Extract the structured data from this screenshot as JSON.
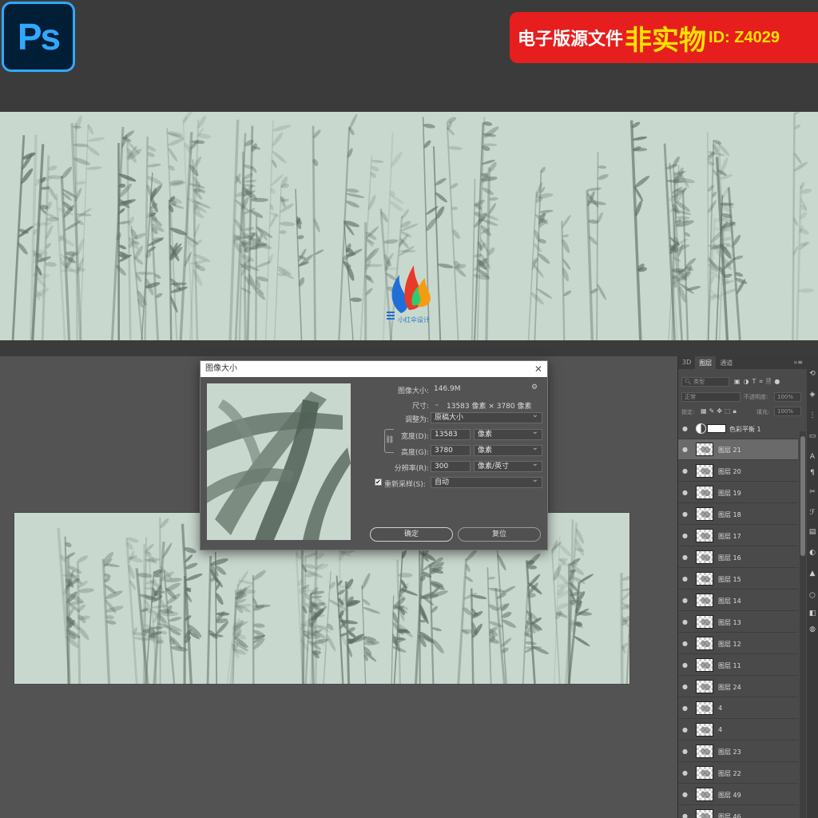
{
  "app": {
    "logo_text": "Ps"
  },
  "promo": {
    "part1": "电子版源文件",
    "part2": "非实物",
    "part3": "ID: Z4029"
  },
  "brand": {
    "logo_caption": "小红伞设计"
  },
  "dialog": {
    "title": "图像大小",
    "image_size_label": "图像大小:",
    "image_size_value": "146.9M",
    "dimensions_label": "尺寸:",
    "dimensions_value": "13583 像素 × 3780 像素",
    "fit_label": "调整为:",
    "fit_value": "原稿大小",
    "width_label": "宽度(D):",
    "width_value": "13583",
    "width_unit": "像素",
    "height_label": "高度(G):",
    "height_value": "3780",
    "height_unit": "像素",
    "resolution_label": "分辨率(R):",
    "resolution_value": "300",
    "resolution_unit": "像素/英寸",
    "resample_label": "重新采样(S):",
    "resample_value": "自动",
    "resample_checked": true,
    "ok_label": "确定",
    "reset_label": "复位"
  },
  "layers_panel": {
    "tabs": [
      "3D",
      "图层",
      "通道"
    ],
    "active_tab": "图层",
    "search_placeholder": "类型",
    "blend_mode": "正常",
    "opacity_label": "不透明度:",
    "opacity_value": "100%",
    "lock_label": "锁定:",
    "fill_label": "填充:",
    "fill_value": "100%",
    "adjustment_layer": "色彩平衡 1",
    "layers": [
      {
        "name": "图层 21",
        "selected": true
      },
      {
        "name": "图层 20"
      },
      {
        "name": "图层 19"
      },
      {
        "name": "图层 18"
      },
      {
        "name": "图层 17"
      },
      {
        "name": "图层 16"
      },
      {
        "name": "图层 15"
      },
      {
        "name": "图层 14"
      },
      {
        "name": "图层 13"
      },
      {
        "name": "图层 12"
      },
      {
        "name": "图层 11"
      },
      {
        "name": "图层 24"
      },
      {
        "name": "4"
      },
      {
        "name": "4"
      },
      {
        "name": "图层 23"
      },
      {
        "name": "图层 22"
      },
      {
        "name": "图层 49"
      },
      {
        "name": "图层 46"
      }
    ]
  },
  "colors": {
    "banner_bg": "#c9d8cf",
    "bamboo": "#5e6e63",
    "ps_blue": "#31a8ff",
    "promo_red": "#e61e1e",
    "promo_yellow": "#ffe100"
  }
}
